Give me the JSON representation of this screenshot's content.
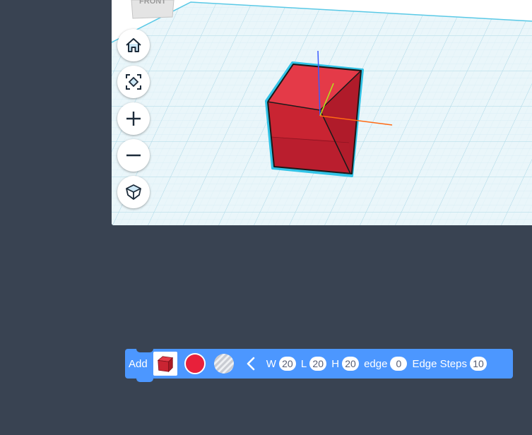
{
  "viewcube": {
    "face_label": "FRONT"
  },
  "nav_buttons": [
    {
      "name": "home",
      "icon": "home-icon"
    },
    {
      "name": "fit",
      "icon": "fit-view-icon"
    },
    {
      "name": "zoom-in",
      "icon": "plus-icon"
    },
    {
      "name": "zoom-out",
      "icon": "minus-icon"
    },
    {
      "name": "projection",
      "icon": "cube-perspective-icon"
    }
  ],
  "colors": {
    "background": "#394352",
    "grid_line": "#bfe3ee",
    "grid_bg": "#e9f6fa",
    "cube_front": "#c92432",
    "cube_top": "#e43a48",
    "cube_right": "#b51c2b",
    "selection_outline": "#32c3e6",
    "axis_x": "#ff6a13",
    "axis_y": "#b4e61b",
    "axis_z": "#3b5cff",
    "toolbar": "#4c97ff",
    "shape_color": "#e8203a"
  },
  "toolbar": {
    "add_label": "Add",
    "shape_icon": "red-cube-icon",
    "color_icon": "color-swatch-icon",
    "hole_icon": "hole-pattern-icon",
    "collapse_icon": "chevron-left-icon",
    "w_label": "W",
    "w_value": "20",
    "l_label": "L",
    "l_value": "20",
    "h_label": "H",
    "h_value": "20",
    "edge_label": "edge",
    "edge_value": "0",
    "edge_steps_label": "Edge Steps",
    "edge_steps_value": "10"
  }
}
